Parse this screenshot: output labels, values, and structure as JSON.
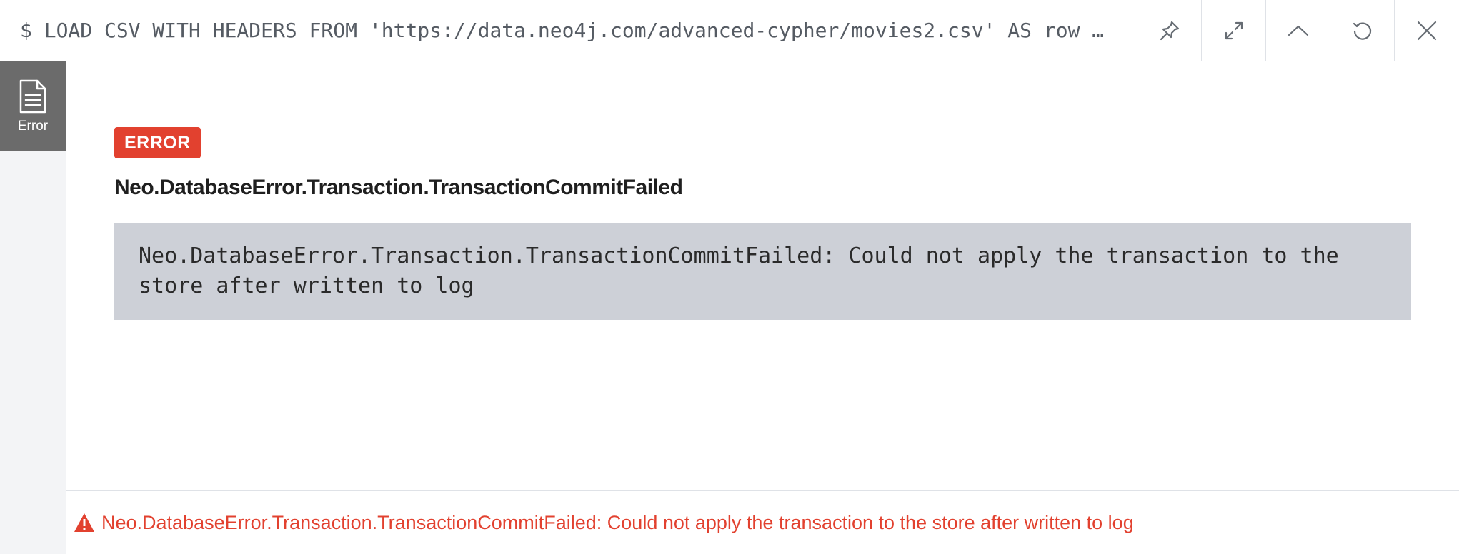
{
  "header": {
    "command": "$ LOAD CSV WITH HEADERS FROM 'https://data.neo4j.com/advanced-cypher/movies2.csv' AS row …",
    "tools": [
      "pin-icon",
      "expand-icon",
      "collapse-icon",
      "rerun-icon",
      "close-icon"
    ]
  },
  "sidebar": {
    "tab_label": "Error",
    "tab_icon": "document-icon"
  },
  "main": {
    "badge": "ERROR",
    "title": "Neo.DatabaseError.Transaction.TransactionCommitFailed",
    "message": "Neo.DatabaseError.Transaction.TransactionCommitFailed: Could not apply the transaction to the store after written to log"
  },
  "status": {
    "icon": "warning-icon",
    "text": "Neo.DatabaseError.Transaction.TransactionCommitFailed: Could not apply the transaction to the store after written to log"
  },
  "colors": {
    "error": "#e2412f",
    "sidebar_active": "#6b6b6b",
    "code_box": "#cdd0d7"
  }
}
